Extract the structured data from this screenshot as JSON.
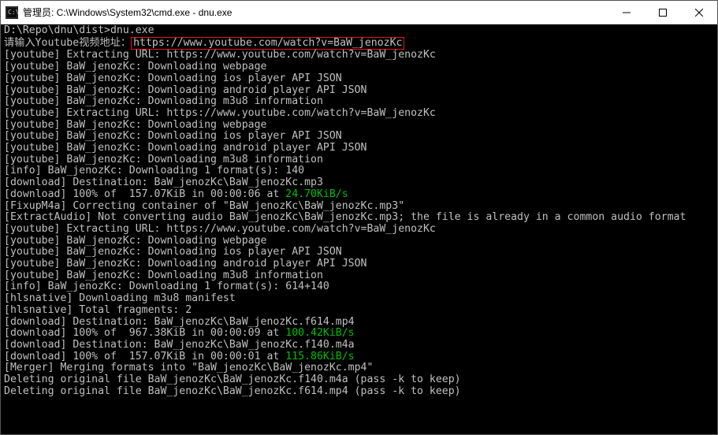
{
  "titlebar": {
    "title": "管理员: C:\\Windows\\System32\\cmd.exe - dnu.exe"
  },
  "term": {
    "prompt": "D:\\Repo\\dnu\\dist>dnu.exe",
    "input_prefix": "请输入Youtube视频地址：",
    "input_url": "https://www.youtube.com/watch?v=BaW_jenozKc",
    "l03": "[youtube] Extracting URL: https://www.youtube.com/watch?v=BaW_jenozKc",
    "l04": "[youtube] BaW_jenozKc: Downloading webpage",
    "l05": "[youtube] BaW_jenozKc: Downloading ios player API JSON",
    "l06": "[youtube] BaW_jenozKc: Downloading android player API JSON",
    "l07": "[youtube] BaW_jenozKc: Downloading m3u8 information",
    "l08": "[youtube] Extracting URL: https://www.youtube.com/watch?v=BaW_jenozKc",
    "l09": "[youtube] BaW_jenozKc: Downloading webpage",
    "l10": "[youtube] BaW_jenozKc: Downloading ios player API JSON",
    "l11": "[youtube] BaW_jenozKc: Downloading android player API JSON",
    "l12": "[youtube] BaW_jenozKc: Downloading m3u8 information",
    "l13": "[info] BaW_jenozKc: Downloading 1 format(s): 140",
    "l14": "[download] Destination: BaW_jenozKc\\BaW_jenozKc.mp3",
    "l15a": "[download] 100% of  157.07KiB in 00:00:06 at ",
    "l15b": "24.70KiB/s",
    "l16": "[FixupM4a] Correcting container of \"BaW_jenozKc\\BaW_jenozKc.mp3\"",
    "l17": "[ExtractAudio] Not converting audio BaW_jenozKc\\BaW_jenozKc.mp3; the file is already in a common audio format",
    "l18": "[youtube] Extracting URL: https://www.youtube.com/watch?v=BaW_jenozKc",
    "l19": "[youtube] BaW_jenozKc: Downloading webpage",
    "l20": "[youtube] BaW_jenozKc: Downloading ios player API JSON",
    "l21": "[youtube] BaW_jenozKc: Downloading android player API JSON",
    "l22": "[youtube] BaW_jenozKc: Downloading m3u8 information",
    "l23": "[info] BaW_jenozKc: Downloading 1 format(s): 614+140",
    "l24": "[hlsnative] Downloading m3u8 manifest",
    "l25": "[hlsnative] Total fragments: 2",
    "l26": "[download] Destination: BaW_jenozKc\\BaW_jenozKc.f614.mp4",
    "l27a": "[download] 100% of  967.38KiB in 00:00:09 at ",
    "l27b": "100.42KiB/s",
    "l28": "[download] Destination: BaW_jenozKc\\BaW_jenozKc.f140.m4a",
    "l29a": "[download] 100% of  157.07KiB in 00:00:01 at ",
    "l29b": "115.86KiB/s",
    "l30": "[Merger] Merging formats into \"BaW_jenozKc\\BaW_jenozKc.mp4\"",
    "l31": "Deleting original file BaW_jenozKc\\BaW_jenozKc.f140.m4a (pass -k to keep)",
    "l32": "Deleting original file BaW_jenozKc\\BaW_jenozKc.f614.mp4 (pass -k to keep)"
  }
}
